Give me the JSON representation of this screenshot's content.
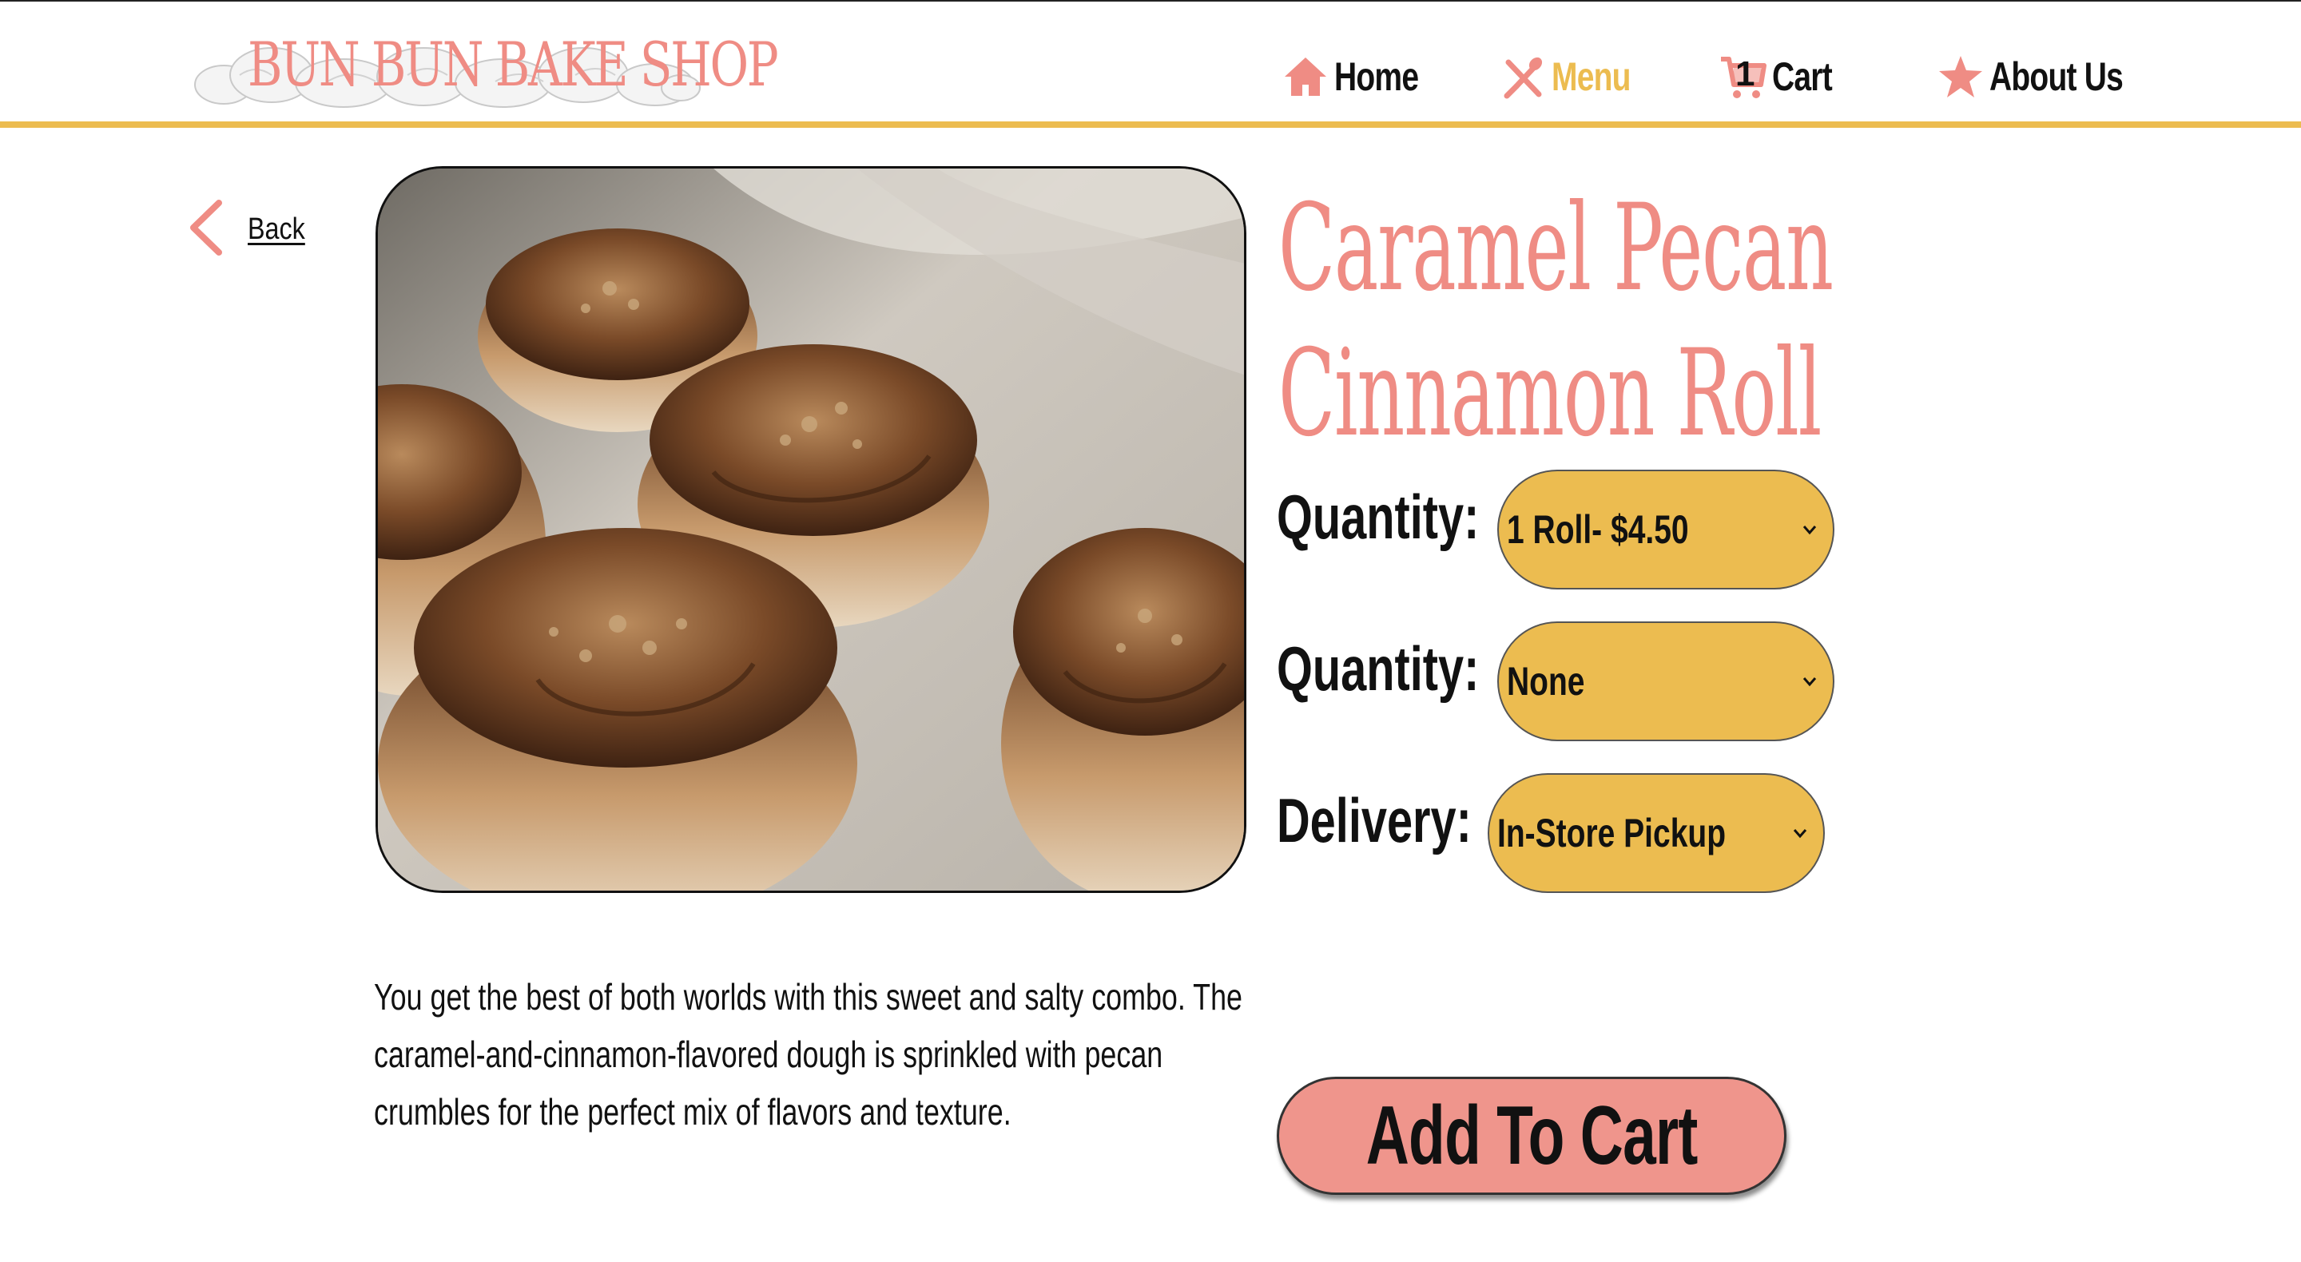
{
  "header": {
    "logo_text": "BUN BUN BAKE SHOP",
    "nav": {
      "home": "Home",
      "menu": "Menu",
      "cart": "Cart",
      "cart_count": "1",
      "about": "About Us"
    }
  },
  "back_label": "Back",
  "product": {
    "title_line1": "Caramel Pecan",
    "title_line2": "Cinnamon Roll",
    "options": {
      "quantity_label": "Quantity:",
      "quantity_value": "1 Roll- $4.50",
      "quantity2_label": "Quantity:",
      "quantity2_value": "None",
      "delivery_label": "Delivery:",
      "delivery_value": "In-Store Pickup"
    },
    "description": "You get the best of both worlds with this sweet and salty combo. The caramel-and-cinnamon-flavored dough is sprinkled with pecan crumbles for the perfect mix of flavors and texture.",
    "add_to_cart_label": "Add To Cart"
  },
  "colors": {
    "accent_pink": "#ef8c84",
    "accent_yellow": "#ecbc50",
    "button_pink": "#ef958c"
  },
  "icons": [
    "house-icon",
    "fork-knife-icon",
    "cart-icon",
    "star-icon",
    "chevron-left-icon",
    "chevron-down-icon"
  ]
}
